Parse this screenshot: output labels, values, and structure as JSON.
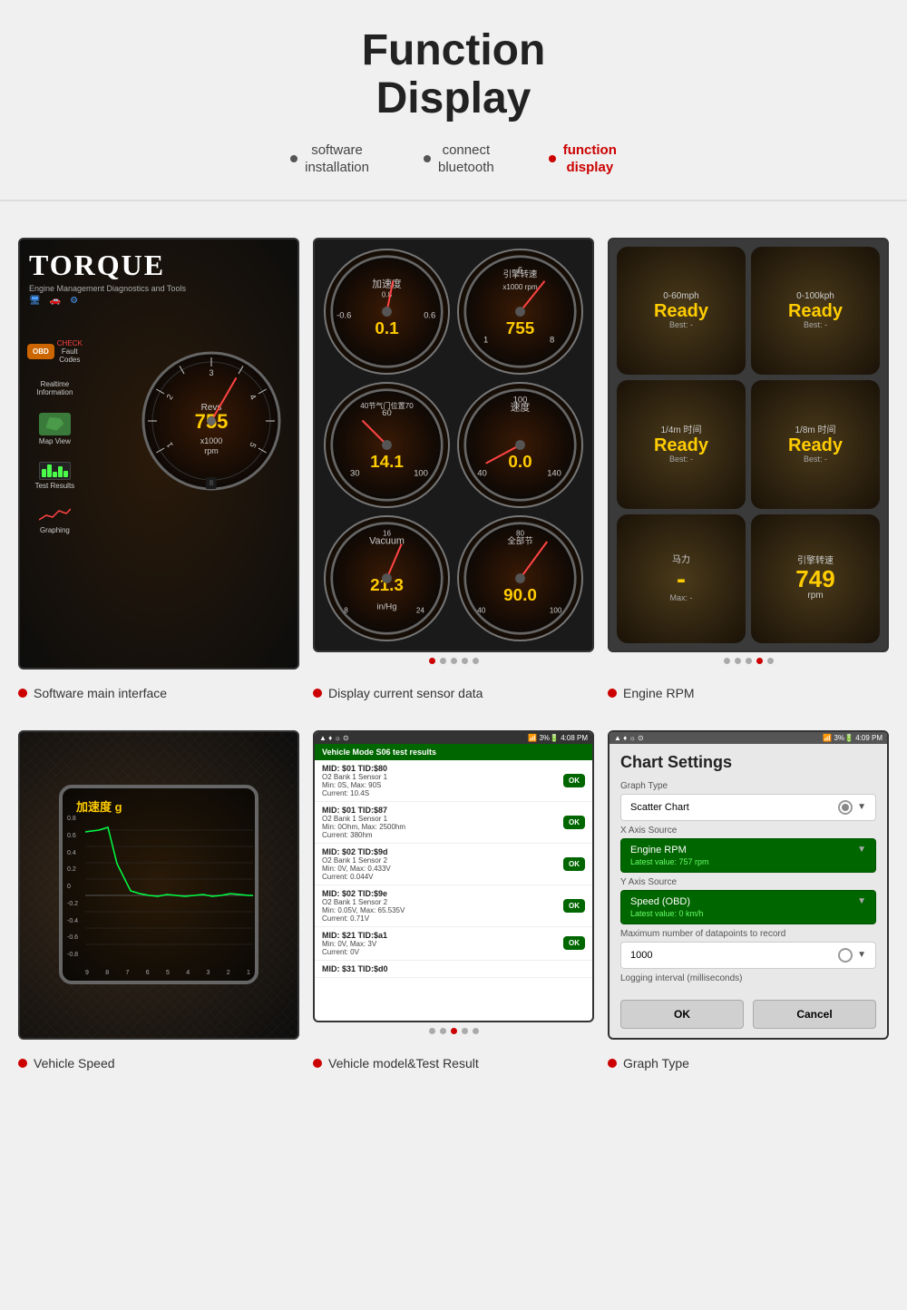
{
  "header": {
    "title": "Function\nDisplay",
    "title_line1": "Function",
    "title_line2": "Display",
    "steps": [
      {
        "label": "software\ninstallation",
        "label_line1": "software",
        "label_line2": "installation",
        "active": false
      },
      {
        "label": "connect\nbluetooth",
        "label_line1": "connect",
        "label_line2": "bluetooth",
        "active": false
      },
      {
        "label": "function\ndisplay",
        "label_line1": "function",
        "label_line2": "display",
        "active": true
      }
    ]
  },
  "captions_row1": [
    {
      "text": "Software main interface"
    },
    {
      "text": "Display current sensor data"
    },
    {
      "text": "Engine RPM"
    }
  ],
  "captions_row2": [
    {
      "text": "Vehicle Speed"
    },
    {
      "text": "Vehicle model&Test Result"
    },
    {
      "text": "Graph Type"
    }
  ],
  "screen1": {
    "logo": "TORQUE",
    "tagline": "Engine Management Diagnostics and Tools",
    "revs_label": "Revs",
    "revs_value": "755",
    "rpm_unit": "x1000\nrpm",
    "realtime_label": "Realtime\nInformation",
    "fault_codes": "Fault\nCodes",
    "map_view": "Map\nView",
    "test_results": "Test\nResults",
    "graphing": "Graphing",
    "check_label": "CHECK"
  },
  "screen2": {
    "gauges": [
      {
        "label": "加速度",
        "value": "0.1"
      },
      {
        "label": "引擎转速 x1000rpm",
        "value": "755"
      },
      {
        "label": "40节气门位置70",
        "value": "14.1"
      },
      {
        "label": "速度",
        "value": "0.0"
      },
      {
        "label": "Vacuum",
        "value": "21.3",
        "unit": "in/Hg"
      },
      {
        "label": "全部节",
        "value": "90.0"
      }
    ]
  },
  "screen3": {
    "widgets": [
      {
        "top_label": "0-60mph",
        "value": "Ready",
        "bottom_label": "Best: -"
      },
      {
        "top_label": "0-100kph",
        "value": "Ready",
        "bottom_label": "Best: -"
      },
      {
        "top_label": "1/4m 时间",
        "value": "Ready",
        "bottom_label": "Best: -"
      },
      {
        "top_label": "1/8m 时间",
        "value": "Ready",
        "bottom_label": "Best: -"
      },
      {
        "top_label": "马力",
        "value": "-",
        "bottom_label": "Max: -"
      },
      {
        "top_label": "引擎转速",
        "value": "749",
        "bottom_label": "rpm"
      }
    ]
  },
  "screen4": {
    "label": "加速度 g",
    "y_axis": [
      "0.8",
      "0.6",
      "0.4",
      "0.2",
      "0",
      "-0.2",
      "-0.4",
      "-0.6",
      "-0.8"
    ],
    "x_axis": [
      "9",
      "8",
      "7",
      "6",
      "5",
      "4",
      "3",
      "2",
      "1"
    ]
  },
  "screen5": {
    "status_bar_left": "▲ ♦ ☼ ⊙",
    "status_bar_right": "📶 3%🔋 4:08 PM",
    "title": "Vehicle Mode S06 test results",
    "items": [
      {
        "header": "MID: $01 TID:$80",
        "sub1": "O2 Bank 1 Sensor 1",
        "sub2": "Min: 0S, Max: 90S",
        "sub3": "Current: 10.4S",
        "has_check": true
      },
      {
        "header": "MID: $01 TID:$87",
        "sub1": "O2 Bank 1 Sensor 1",
        "sub2": "Min: 0Ohm, Max: 2500hm",
        "sub3": "Current: 380hm",
        "has_check": true
      },
      {
        "header": "MID: $02 TID:$9d",
        "sub1": "O2 Bank 1 Sensor 2",
        "sub2": "Min: 0V, Max: 0.433V",
        "sub3": "Current: 0.044V",
        "has_check": true
      },
      {
        "header": "MID: $02 TID:$9e",
        "sub1": "O2 Bank 1 Sensor 2",
        "sub2": "Min: 0.05V, Max: 65.535V",
        "sub3": "Current: 0.71V",
        "has_check": true
      },
      {
        "header": "MID: $21 TID:$a1",
        "sub1": "",
        "sub2": "Min: 0V, Max: 3V",
        "sub3": "Current: 0V",
        "has_check": true
      },
      {
        "header": "MID: $31 TID:$d0",
        "sub1": "",
        "sub2": "",
        "sub3": "",
        "has_check": false
      }
    ]
  },
  "screen6": {
    "status_bar_left": "▲ ♦ ☼ ⊙",
    "status_bar_right": "📶 3%🔋 4:09 PM",
    "title": "Chart Settings",
    "graph_type_label": "Graph Type",
    "graph_type_value": "Scatter Chart",
    "x_axis_label": "X Axis Source",
    "x_axis_value": "Engine RPM",
    "x_axis_sub": "Latest value: 757 rpm",
    "y_axis_label": "Y Axis Source",
    "y_axis_value": "Speed (OBD)",
    "y_axis_sub": "Latest value: 0 km/h",
    "max_label": "Maximum number of datapoints to record",
    "max_value": "1000",
    "interval_label": "Logging interval (milliseconds)",
    "ok_btn": "OK",
    "cancel_btn": "Cancel"
  }
}
